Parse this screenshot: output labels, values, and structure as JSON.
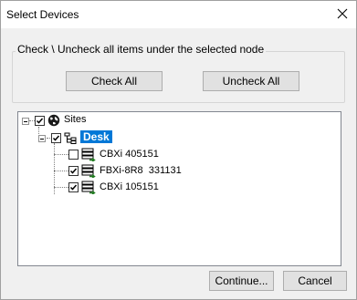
{
  "window": {
    "title": "Select Devices"
  },
  "group": {
    "label": "Check \\ Uncheck all items under the selected node",
    "check_all": "Check All",
    "uncheck_all": "Uncheck All"
  },
  "tree": {
    "root": {
      "label": "Sites",
      "checked": true,
      "expanded": true,
      "icon": "globe-icon"
    },
    "site": {
      "label": "Desk",
      "checked": true,
      "expanded": true,
      "selected": true,
      "icon": "network-icon"
    },
    "devices": [
      {
        "label": "CBXi 405151",
        "checked": false,
        "icon": "device-icon"
      },
      {
        "label": "FBXi-8R8  331131",
        "checked": true,
        "icon": "device-icon"
      },
      {
        "label": "CBXi 105151",
        "checked": true,
        "icon": "device-icon"
      }
    ]
  },
  "footer": {
    "continue": "Continue...",
    "cancel": "Cancel"
  }
}
